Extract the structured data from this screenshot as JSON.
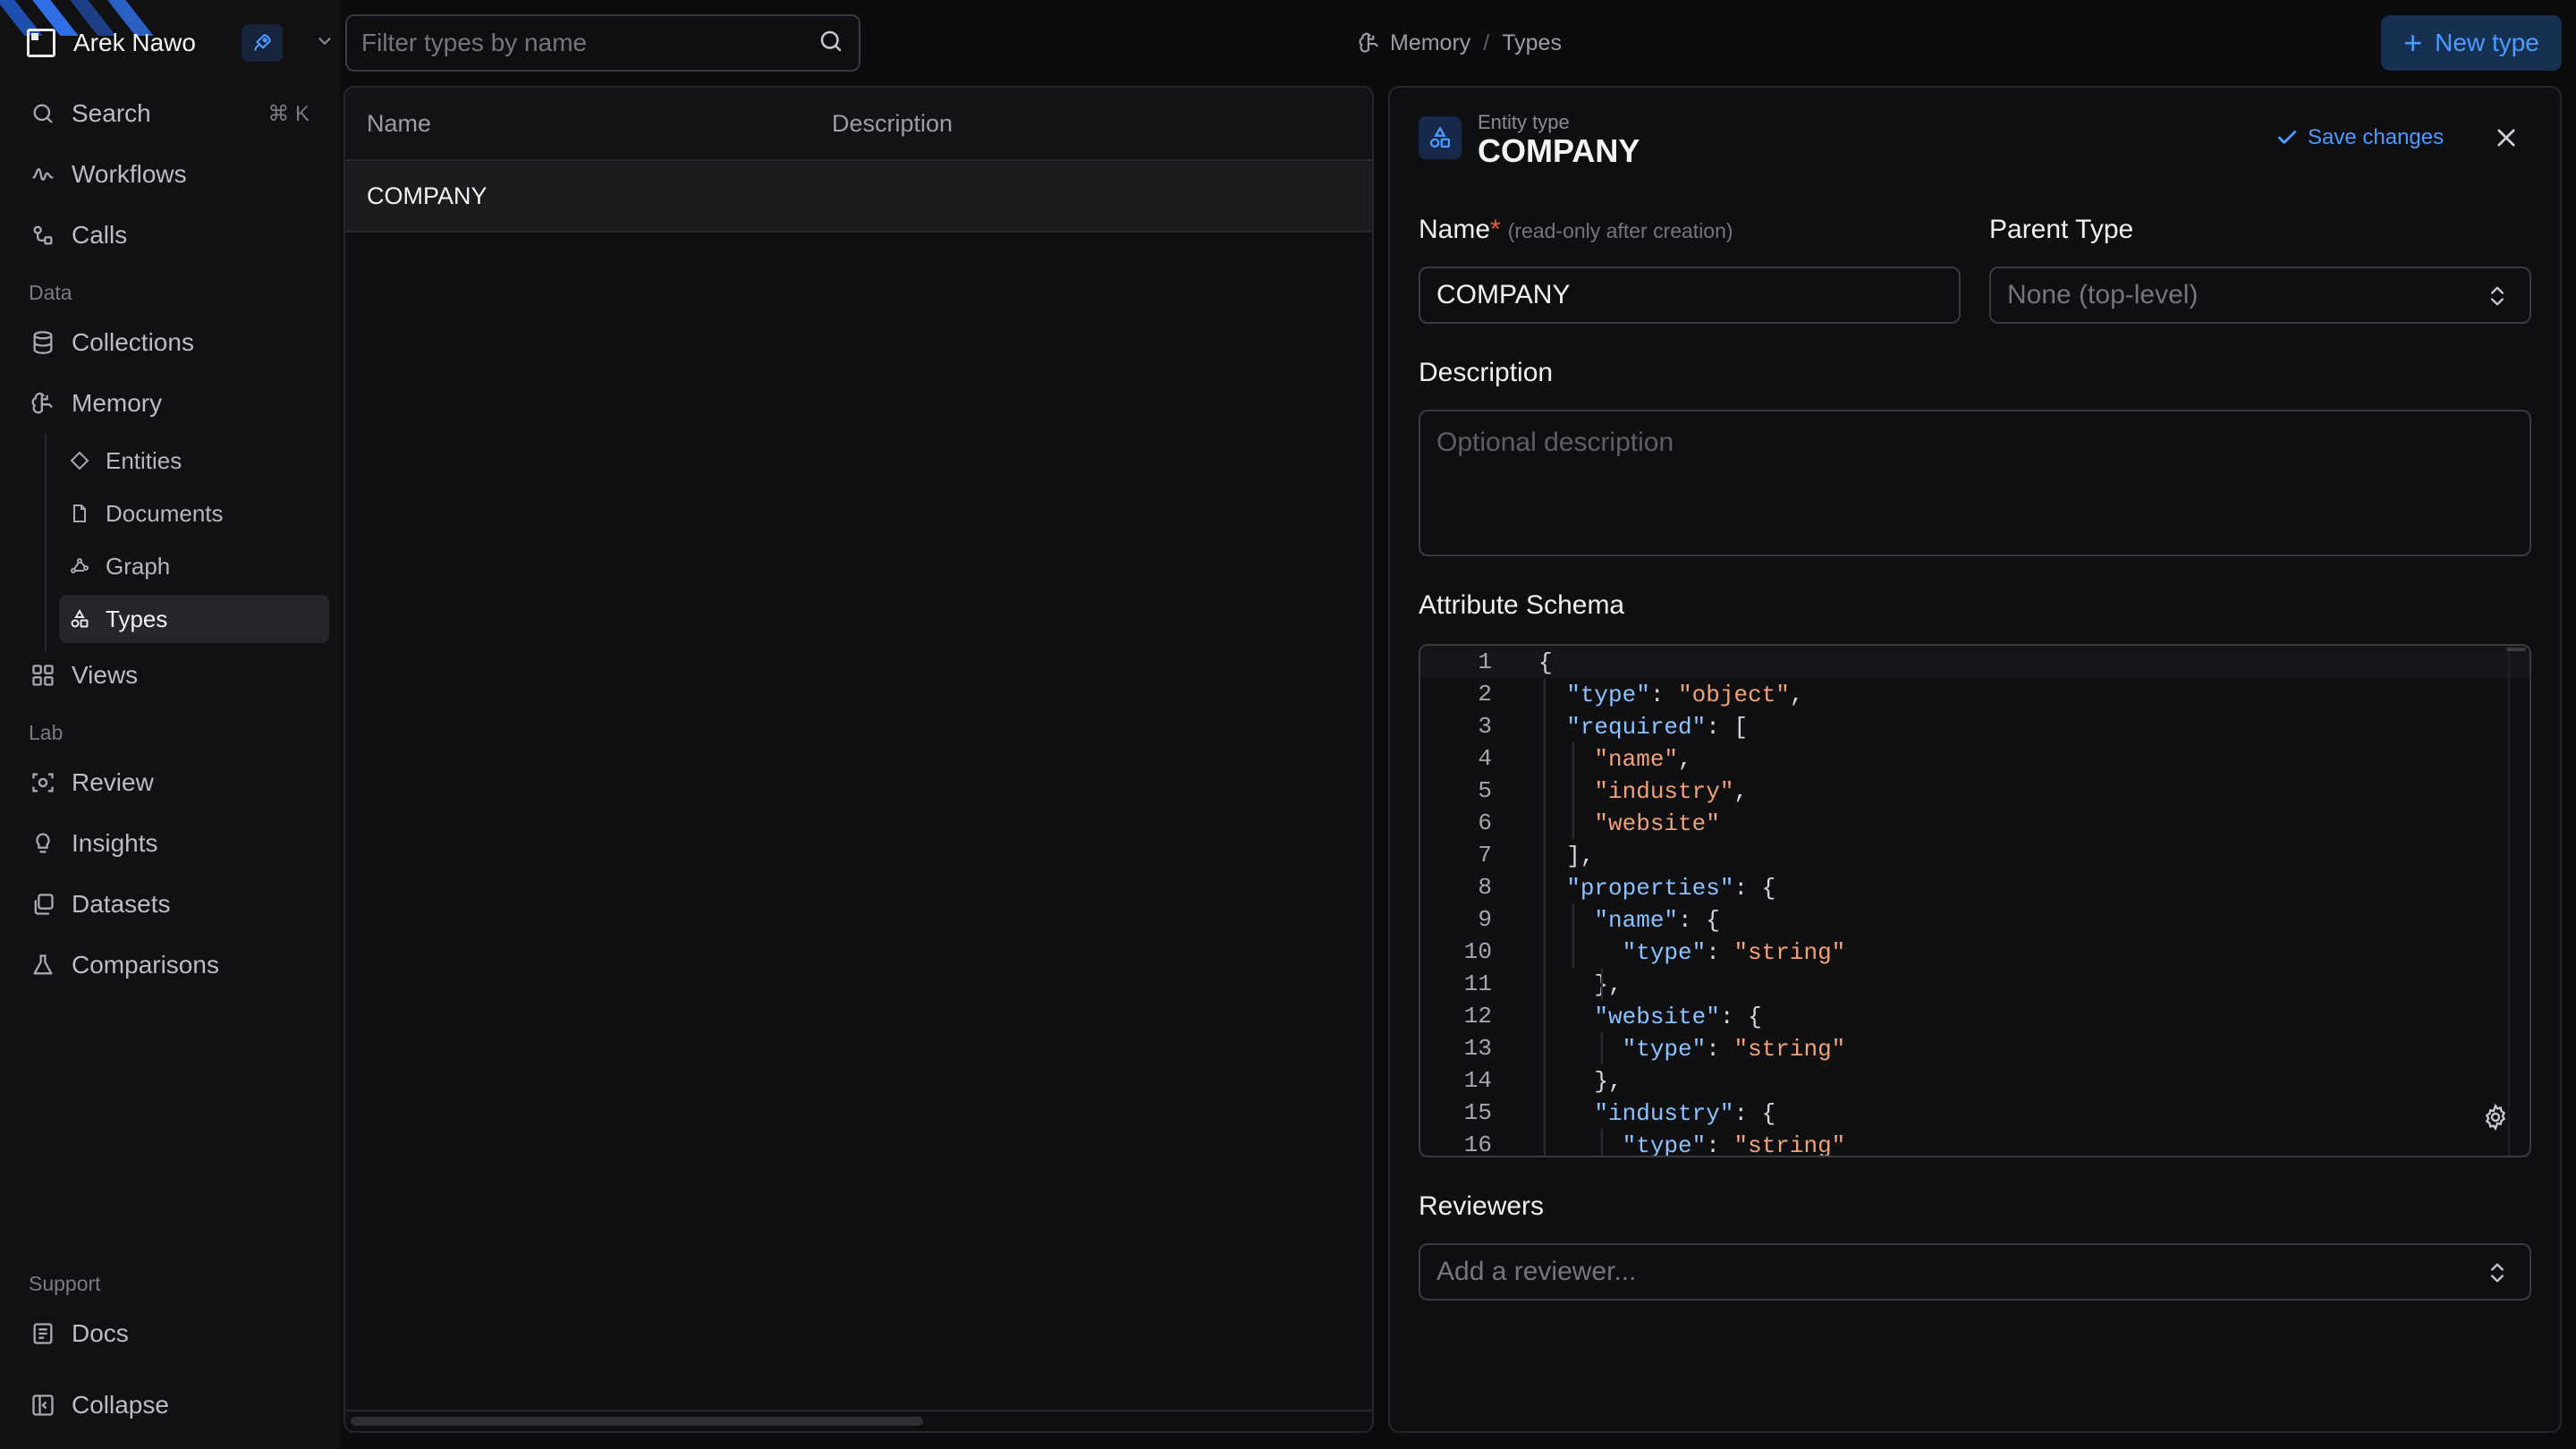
{
  "workspace": {
    "name": "Arek Nawo"
  },
  "nav": {
    "search": {
      "label": "Search",
      "shortcut": "⌘ K"
    },
    "workflows": "Workflows",
    "calls": "Calls",
    "data_section": "Data",
    "collections": "Collections",
    "memory": "Memory",
    "memory_items": [
      "Entities",
      "Documents",
      "Graph",
      "Types"
    ],
    "views": "Views",
    "lab_section": "Lab",
    "review": "Review",
    "insights": "Insights",
    "datasets": "Datasets",
    "comparisons": "Comparisons",
    "support_section": "Support",
    "docs": "Docs",
    "collapse": "Collapse"
  },
  "topbar": {
    "filter_placeholder": "Filter types by name",
    "breadcrumb": [
      "Memory",
      "Types"
    ],
    "new_button": "New type"
  },
  "table": {
    "columns": [
      "Name",
      "Description"
    ],
    "rows": [
      {
        "name": "COMPANY",
        "description": ""
      }
    ]
  },
  "detail": {
    "kind_label": "Entity type",
    "title": "COMPANY",
    "save_label": "Save changes",
    "name_label": "Name",
    "name_required_mark": "*",
    "name_hint": "(read-only after creation)",
    "name_value": "COMPANY",
    "parent_label": "Parent Type",
    "parent_value": "None (top-level)",
    "description_label": "Description",
    "description_placeholder": "Optional description",
    "schema_label": "Attribute Schema",
    "schema_lines": [
      "{",
      "  \"type\": \"object\",",
      "  \"required\": [",
      "    \"name\",",
      "    \"industry\",",
      "    \"website\"",
      "  ],",
      "  \"properties\": {",
      "    \"name\": {",
      "      \"type\": \"string\"",
      "    },",
      "    \"website\": {",
      "      \"type\": \"string\"",
      "    },",
      "    \"industry\": {",
      "      \"type\": \"string\""
    ],
    "reviewers_label": "Reviewers",
    "reviewers_placeholder": "Add a reviewer..."
  },
  "colors": {
    "accent": "#4c9bff",
    "background": "#0c0c0e",
    "json_key": "#8cc2ff",
    "json_string": "#f0a27a"
  }
}
